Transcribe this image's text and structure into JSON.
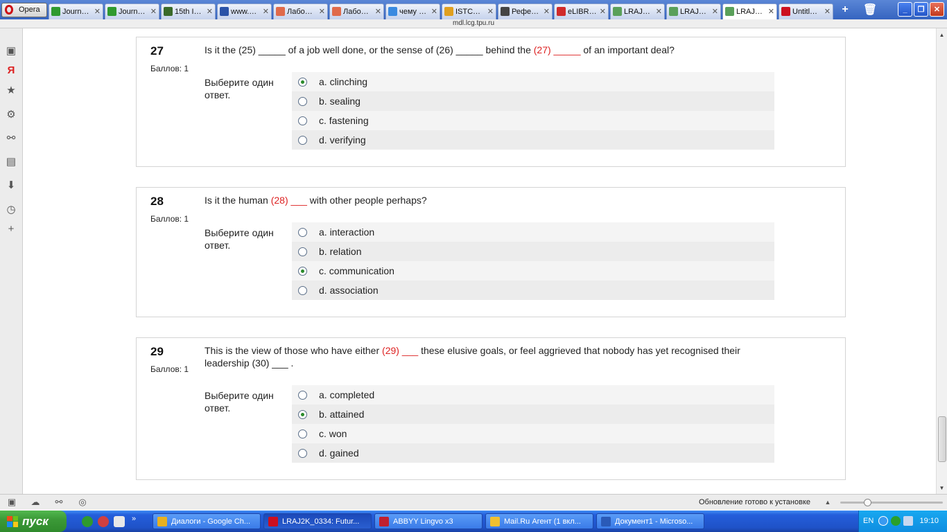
{
  "browser": {
    "menu_label": "Opera",
    "tabs": [
      {
        "label": "Journ…",
        "fav": "#2f9a2f"
      },
      {
        "label": "Journ…",
        "fav": "#2f9a2f"
      },
      {
        "label": "15th I…",
        "fav": "#3a6a2a"
      },
      {
        "label": "www.…",
        "fav": "#2a52a8"
      },
      {
        "label": "Лабо…",
        "fav": "#e06a4a"
      },
      {
        "label": "Лабо…",
        "fav": "#e06a4a"
      },
      {
        "label": "чему …",
        "fav": "#3a8ae0"
      },
      {
        "label": "ISTC…",
        "fav": "#e0a020"
      },
      {
        "label": "Рефе…",
        "fav": "#444444"
      },
      {
        "label": "eLIBR…",
        "fav": "#d02a2a"
      },
      {
        "label": "LRAJ…",
        "fav": "#5aa05a"
      },
      {
        "label": "LRAJ…",
        "fav": "#5aa05a"
      },
      {
        "label": "LRAJ…",
        "fav": "#5aa05a",
        "active": true
      },
      {
        "label": "Untitl…",
        "fav": "#cc1020"
      }
    ],
    "new_tab_icon": "plus-icon",
    "trash_icon": "trash-icon",
    "address": "mdl.lcg.tpu.ru"
  },
  "questions": [
    {
      "number": "27",
      "grade": "Баллов: 1",
      "text_parts": [
        {
          "t": "Is it the (25) _____ of a job well done, or the sense of  (26) _____  behind the ",
          "red": false
        },
        {
          "t": "(27) _____",
          "red": true
        },
        {
          "t": " of an important deal?",
          "red": false
        }
      ],
      "prompt": "Выберите один ответ.",
      "answers": [
        {
          "label": "a. clinching",
          "selected": true
        },
        {
          "label": "b. sealing",
          "selected": false
        },
        {
          "label": "c. fastening",
          "selected": false
        },
        {
          "label": "d. verifying",
          "selected": false
        }
      ]
    },
    {
      "number": "28",
      "grade": "Баллов: 1",
      "text_parts": [
        {
          "t": "Is it the human ",
          "red": false
        },
        {
          "t": "(28) ___",
          "red": true
        },
        {
          "t": "  with other people perhaps?",
          "red": false
        }
      ],
      "prompt": "Выберите один ответ.",
      "answers": [
        {
          "label": "a. interaction",
          "selected": false
        },
        {
          "label": "b. relation",
          "selected": false
        },
        {
          "label": "c. communication",
          "selected": true
        },
        {
          "label": "d. association",
          "selected": false
        }
      ]
    },
    {
      "number": "29",
      "grade": "Баллов: 1",
      "text_parts": [
        {
          "t": "This is the view of those who have either ",
          "red": false
        },
        {
          "t": "(29) ___",
          "red": true
        },
        {
          "t": "  these elusive goals, or feel aggrieved that nobody has yet recognised their leadership (30) ___ .",
          "red": false
        }
      ],
      "prompt": "Выберите один ответ.",
      "answers": [
        {
          "label": "a. completed",
          "selected": false
        },
        {
          "label": "b. attained",
          "selected": true
        },
        {
          "label": "c. won",
          "selected": false
        },
        {
          "label": "d. gained",
          "selected": false
        }
      ]
    }
  ],
  "status": {
    "update_text": "Обновление готово к установке"
  },
  "taskbar": {
    "start_label": "пуск",
    "tasks": [
      {
        "label": "Диалоги - Google Ch...",
        "color": "#e8b020",
        "active": false
      },
      {
        "label": "LRAJ2K_0334: Futur...",
        "color": "#cc1020",
        "active": true
      },
      {
        "label": "ABBYY Lingvo x3",
        "color": "#c02030",
        "active": false
      },
      {
        "label": "Mail.Ru Агент (1 вкл...",
        "color": "#f0c030",
        "active": false
      },
      {
        "label": "Документ1 - Microso...",
        "color": "#2a5ab8",
        "active": false
      }
    ],
    "lang": "EN",
    "clock": "19:10"
  }
}
